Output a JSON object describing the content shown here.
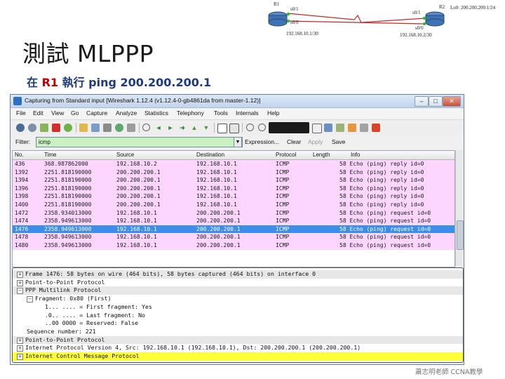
{
  "slide": {
    "title": "測試 MLPPP",
    "subtitle_prefix": "在 ",
    "subtitle_router": "R1",
    "subtitle_rest": " 執行 ping 200.200.200.1",
    "footer": "蕭志明老師 CCNA教學"
  },
  "topology": {
    "r1": "R1",
    "r1_s01": "s0/1",
    "r1_s00": "s0/0",
    "r1_ip": "192.168.10.1/30",
    "r2": "R2",
    "r2_s01": "s0/1",
    "r2_s00": "s0/0",
    "r2_ip": "192.168.10.2/30",
    "r2_lo": "Lo0: 200.200.200.1/24"
  },
  "window": {
    "title": "Capturing from Standard input   [Wireshark 1.12.4  (v1.12.4-0-gb4861da from master-1.12)]",
    "minimize": "–",
    "maximize": "□",
    "close": "✕"
  },
  "menu": [
    "File",
    "Edit",
    "View",
    "Go",
    "Capture",
    "Analyze",
    "Statistics",
    "Telephony",
    "Tools",
    "Internals",
    "Help"
  ],
  "toolbar_icons": [
    "interface-icon",
    "options-icon",
    "start-icon",
    "stop-icon",
    "restart-icon",
    "open-icon",
    "save-icon",
    "close-file-icon",
    "reload-icon",
    "print-icon",
    "find-icon",
    "back-icon",
    "forward-icon",
    "goto-icon",
    "top-icon",
    "bottom-icon",
    "colorize-icon",
    "autoscroll-icon",
    "zoom-in-icon",
    "zoom-out-icon",
    "zoom-normal-icon",
    "resize-icon",
    "capture-filter-icon",
    "display-filter-icon",
    "coloring-icon",
    "prefs-icon",
    "help-icon"
  ],
  "filter": {
    "label": "Filter:",
    "value": "icmp",
    "expression": "Expression...",
    "clear": "Clear",
    "apply": "Apply",
    "save": "Save"
  },
  "packet_list": {
    "columns": [
      "No.",
      "Time",
      "Source",
      "Destination",
      "Protocol",
      "Length",
      "Info"
    ],
    "rows": [
      {
        "no": "436",
        "time": "368.987862000",
        "src": "192.168.10.2",
        "dst": "192.168.10.1",
        "proto": "ICMP",
        "len": "",
        "info": "58 Echo (ping) reply   id=0"
      },
      {
        "no": "1392",
        "time": "2251.818190000",
        "src": "200.200.200.1",
        "dst": "192.168.10.1",
        "proto": "ICMP",
        "len": "",
        "info": "58 Echo (ping) reply   id=0"
      },
      {
        "no": "1394",
        "time": "2251.818190000",
        "src": "200.200.200.1",
        "dst": "192.168.10.1",
        "proto": "ICMP",
        "len": "",
        "info": "58 Echo (ping) reply   id=0"
      },
      {
        "no": "1396",
        "time": "2251.818190000",
        "src": "200.200.200.1",
        "dst": "192.168.10.1",
        "proto": "ICMP",
        "len": "",
        "info": "58 Echo (ping) reply   id=0"
      },
      {
        "no": "1398",
        "time": "2251.818190000",
        "src": "200.200.200.1",
        "dst": "192.168.10.1",
        "proto": "ICMP",
        "len": "",
        "info": "58 Echo (ping) reply   id=0"
      },
      {
        "no": "1400",
        "time": "2251.818190000",
        "src": "200.200.200.1",
        "dst": "192.168.10.1",
        "proto": "ICMP",
        "len": "",
        "info": "58 Echo (ping) reply   id=0"
      },
      {
        "no": "1472",
        "time": "2358.934013000",
        "src": "192.168.10.1",
        "dst": "200.200.200.1",
        "proto": "ICMP",
        "len": "",
        "info": "58 Echo (ping) request id=0"
      },
      {
        "no": "1474",
        "time": "2358.949613000",
        "src": "192.168.10.1",
        "dst": "200.200.200.1",
        "proto": "ICMP",
        "len": "",
        "info": "58 Echo (ping) request id=0"
      },
      {
        "no": "1476",
        "time": "2358.949613000",
        "src": "192.168.10.1",
        "dst": "200.200.200.1",
        "proto": "ICMP",
        "len": "",
        "info": "58 Echo (ping) request id=0",
        "selected": true
      },
      {
        "no": "1478",
        "time": "2358.949613000",
        "src": "192.168.10.1",
        "dst": "200.200.200.1",
        "proto": "ICMP",
        "len": "",
        "info": "58 Echo (ping) request id=0"
      },
      {
        "no": "1480",
        "time": "2358.949613000",
        "src": "192.168.10.1",
        "dst": "200.200.200.1",
        "proto": "ICMP",
        "len": "",
        "info": "58 Echo (ping) request id=0"
      }
    ]
  },
  "details": [
    {
      "text": "Frame 1476: 58 bytes on wire (464 bits), 58 bytes captured (464 bits) on interface 0",
      "expander": "+",
      "style": "gray",
      "indent": 0
    },
    {
      "text": "Point-to-Point Protocol",
      "expander": "+",
      "style": "",
      "indent": 0
    },
    {
      "text": "PPP Multilink Protocol",
      "expander": "−",
      "style": "gray",
      "indent": 0
    },
    {
      "text": "Fragment: 0x80 (First)",
      "expander": "−",
      "style": "",
      "indent": 1
    },
    {
      "text": "1... .... = First fragment: Yes",
      "expander": "",
      "style": "",
      "indent": 2
    },
    {
      "text": ".0.. .... = Last fragment: No",
      "expander": "",
      "style": "",
      "indent": 2
    },
    {
      "text": "..00 0000 = Reserved: False",
      "expander": "",
      "style": "",
      "indent": 2
    },
    {
      "text": "Sequence number: 221",
      "expander": "",
      "style": "",
      "indent": 1
    },
    {
      "text": "Point-to-Point Protocol",
      "expander": "+",
      "style": "gray",
      "indent": 0
    },
    {
      "text": "Internet Protocol Version 4, Src: 192.168.10.1 (192.168.10.1), Dst: 200.200.200.1 (200.200.200.1)",
      "expander": "+",
      "style": "",
      "indent": 0
    },
    {
      "text": "Internet Control Message Protocol",
      "expander": "+",
      "style": "yellow",
      "indent": 0
    }
  ],
  "colors": {
    "row_icmp": "#fcd6ff",
    "row_selected": "#3d8ee8",
    "filter_ok": "#c9f2c2",
    "detail_highlight": "#ffff3a",
    "subtitle_red": "#c00000",
    "subtitle_blue": "#1f3a7a"
  }
}
